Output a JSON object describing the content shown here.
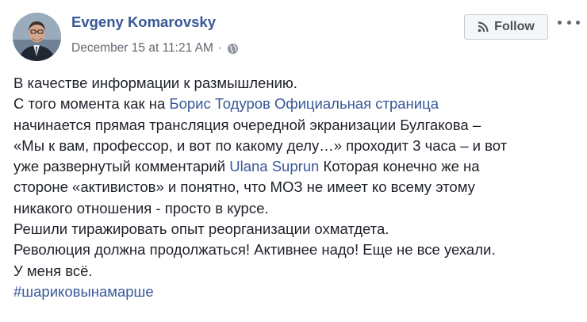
{
  "post": {
    "author": "Evgeny Komarovsky",
    "timestamp": "December 15 at 11:21 AM",
    "separator": "·",
    "privacy_icon": "globe-icon",
    "follow_label": "Follow",
    "follow_icon": "rss-icon",
    "more_icon": "more-options-icon",
    "lines": {
      "l1": "В качестве информации к размышлению.",
      "l2_pre": "С того момента как на ",
      "l2_link": "Борис Тодуров Официальная страница",
      "l3": "начинается прямая трансляция очередной экранизации Булгакова –",
      "l4": "«Мы к вам, профессор, и вот по какому делу…» проходит 3 часа – и вот",
      "l5_pre": "уже развернутый комментарий ",
      "l5_link": "Ulana Suprun",
      "l5_post": " Которая конечно же на",
      "l6": "стороне «активистов» и понятно, что МОЗ не имеет ко всему этому",
      "l7": "никакого отношения - просто в курсе.",
      "l8": "Решили тиражировать опыт реорганизации охматдета.",
      "l9": "Революция должна продолжаться! Активнее надо! Еще не все уехали.",
      "l10": "У меня всё.",
      "hashtag": "#шариковынамарше"
    },
    "colors": {
      "link": "#385898",
      "text": "#1d2129",
      "meta": "#616770",
      "button_bg": "#f5f6f7"
    }
  }
}
